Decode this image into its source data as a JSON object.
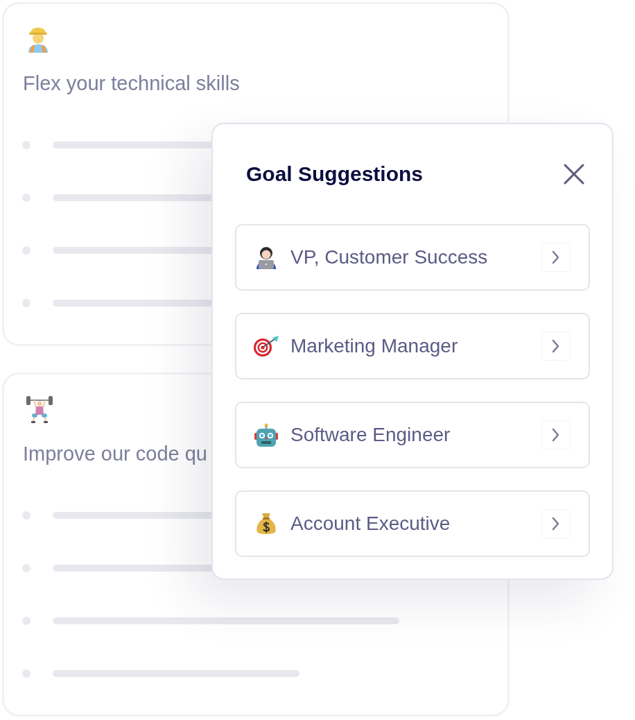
{
  "cards": [
    {
      "title": "Flex your technical skills"
    },
    {
      "title": "Improve our code qu"
    }
  ],
  "dialog": {
    "title": "Goal Suggestions",
    "suggestions": [
      {
        "label": "VP, Customer Success"
      },
      {
        "label": "Marketing Manager"
      },
      {
        "label": "Software Engineer"
      },
      {
        "label": "Account Executive"
      }
    ]
  }
}
